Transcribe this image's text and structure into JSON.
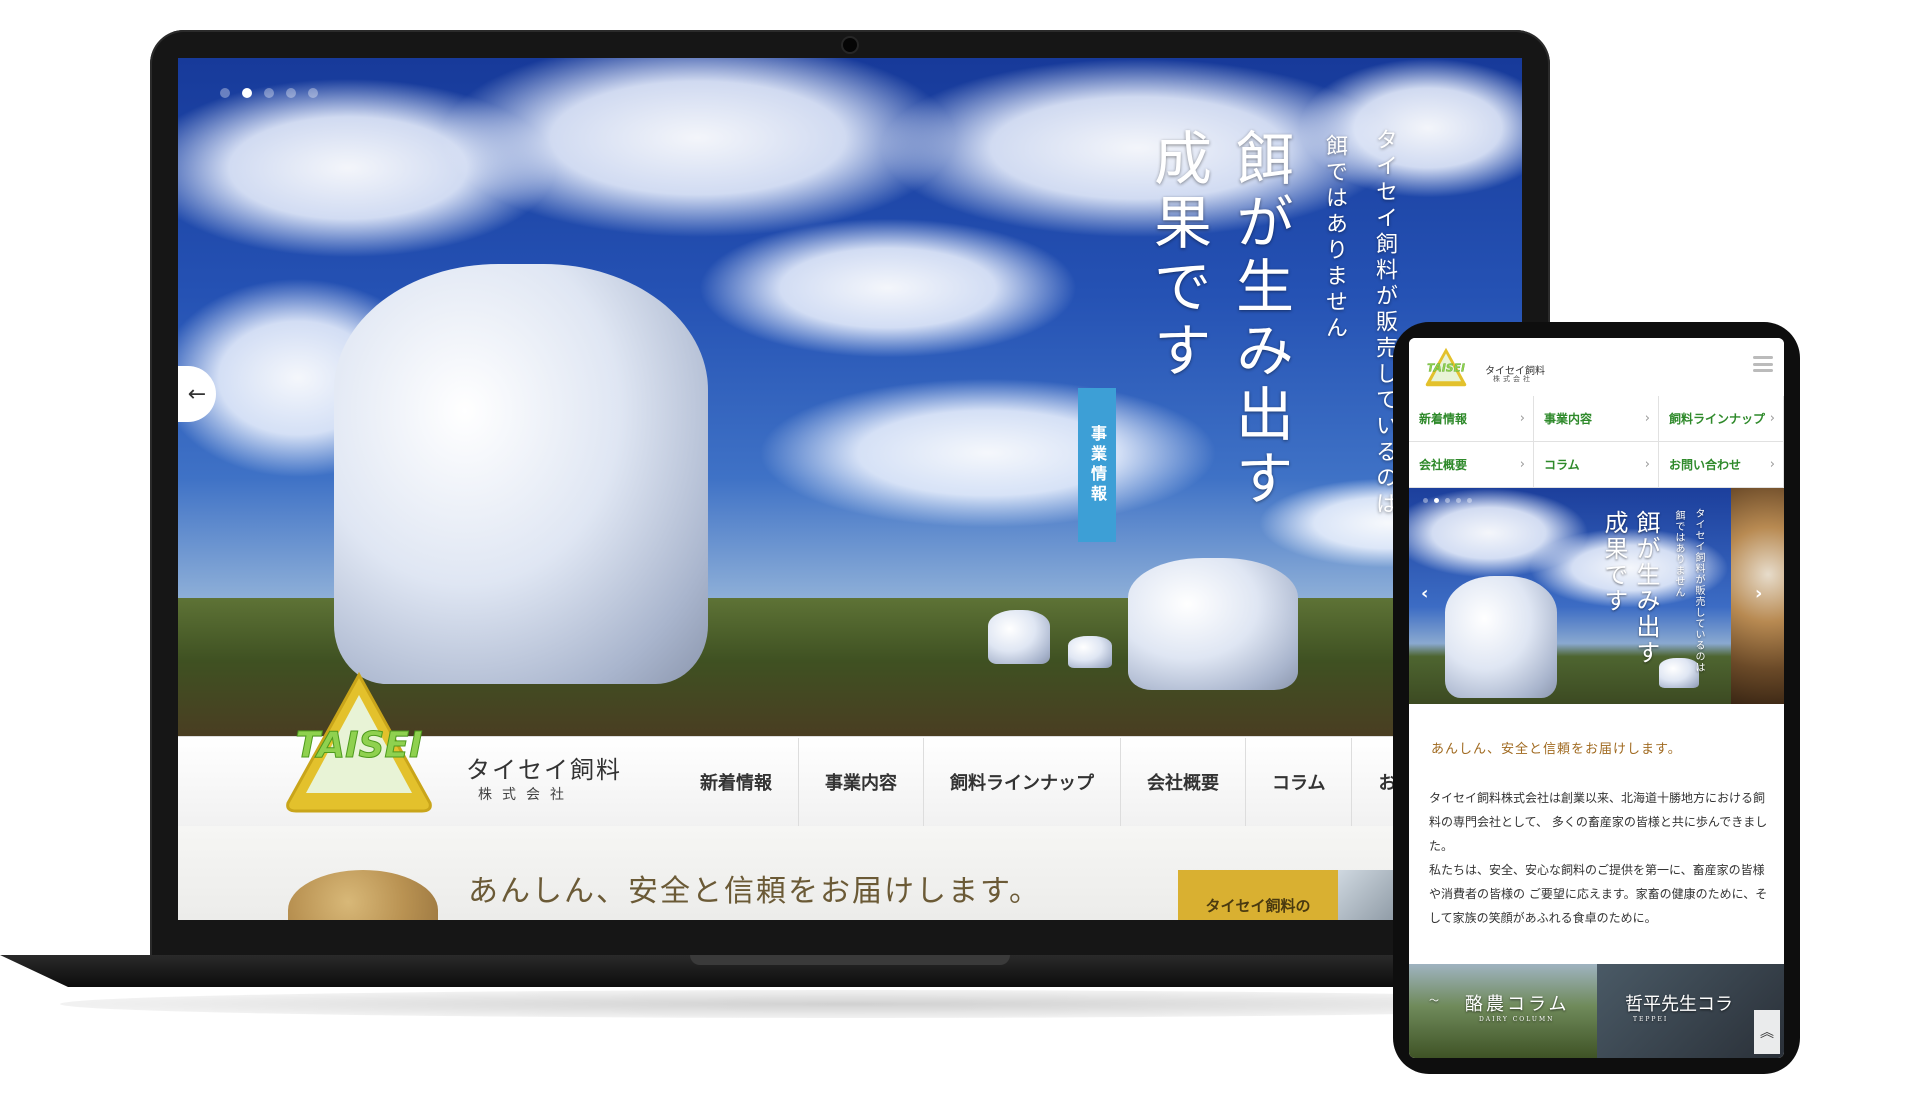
{
  "laptop": {
    "hero": {
      "slide_count": 5,
      "active_slide": 2,
      "sub_line1": "タイセイ飼料が販売しているのは",
      "sub_line2": "餌ではありません",
      "main_line1": "餌が生み出す",
      "main_line2": "成果です",
      "badge": "事業情報",
      "prev_arrow": "←"
    },
    "header": {
      "logo_text": "TAISEI",
      "brand_name": "タイセイ飼料",
      "brand_sub": "株式会社",
      "nav": [
        "新着情報",
        "事業内容",
        "飼料ラインナップ",
        "会社概要",
        "コラム",
        "お"
      ]
    },
    "lower": {
      "tagline": "あんしん、安全と信頼をお届けします。",
      "promo": "タイセイ飼料の"
    }
  },
  "phone": {
    "header": {
      "logo_text": "TAISEI",
      "brand_name": "タイセイ飼料",
      "brand_sub": "株式会社"
    },
    "nav": [
      {
        "label": "新着情報"
      },
      {
        "label": "事業内容"
      },
      {
        "label": "飼料ラインナップ"
      },
      {
        "label": "会社概要"
      },
      {
        "label": "コラム"
      },
      {
        "label": "お問い合わせ"
      }
    ],
    "chevron": "›",
    "hero": {
      "sub_line1": "タイセイ飼料が販売しているのは",
      "sub_line2": "餌ではありません",
      "main_line1": "餌が生み出す",
      "main_line2": "成果です",
      "prev_arrow": "‹",
      "next_arrow": "›"
    },
    "tagline": "あんしん、安全と信頼をお届けします。",
    "body": [
      "タイセイ飼料株式会社は創業以来、北海道十勝地方における飼料の専門会社として、 多くの畜産家の皆様と共に歩んできました。",
      "私たちは、安全、安心な飼料のご提供を第一に、畜産家の皆様や消費者の皆様の ご要望に応えます。家畜の健康のために、そして家族の笑顔があふれる食卓のために。"
    ],
    "columns": [
      {
        "label": "酪農コラム",
        "sub": "DAIRY COLUMN"
      },
      {
        "label": "哲平先生コラ",
        "sub": "TEPPEI"
      }
    ],
    "scroll_top": "︽"
  },
  "colors": {
    "accent_green": "#2f8a2b",
    "badge_blue": "#3d9fd6",
    "logo_yellow": "#e3c12c",
    "logo_green": "#8fd14f",
    "promo_gold": "#d9b031",
    "tagline_brown": "#6b5a36"
  }
}
